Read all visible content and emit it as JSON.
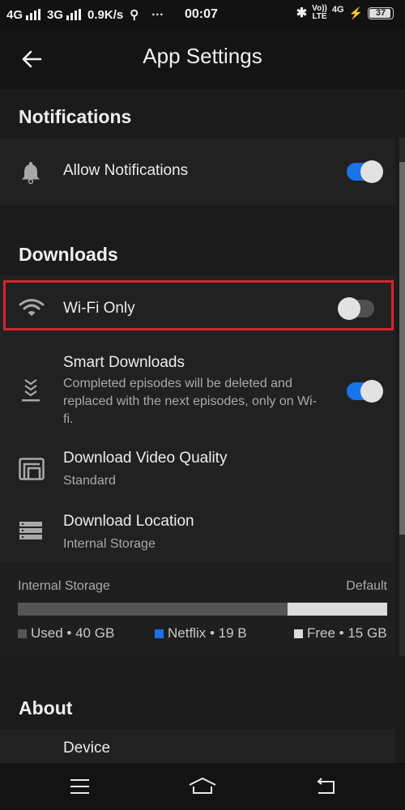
{
  "status_bar": {
    "network1": "4G",
    "network2": "3G",
    "speed": "0.9K/s",
    "usb_icon": "usb-icon",
    "more": "···",
    "time": "00:07",
    "volte_top": "Vo))",
    "volte_bottom": "LTE",
    "data_type": "4G",
    "battery_level": "37"
  },
  "app_bar": {
    "back_icon": "arrow-left-icon",
    "title": "App Settings"
  },
  "sections": {
    "notifications": {
      "heading": "Notifications",
      "allow": {
        "label": "Allow Notifications",
        "icon": "bell-icon",
        "enabled": true
      }
    },
    "downloads": {
      "heading": "Downloads",
      "wifi_only": {
        "label": "Wi-Fi Only",
        "icon": "wifi-icon",
        "enabled": false,
        "highlighted": true
      },
      "smart_downloads": {
        "label": "Smart Downloads",
        "description": "Completed episodes will be deleted and replaced with the next episodes, only on Wi-fi.",
        "icon": "smart-downloads-icon",
        "enabled": true
      },
      "video_quality": {
        "label": "Download Video Quality",
        "value": "Standard",
        "icon": "video-quality-icon"
      },
      "location": {
        "label": "Download Location",
        "value": "Internal Storage",
        "icon": "storage-icon"
      }
    },
    "storage": {
      "title": "Internal Storage",
      "badge": "Default",
      "used_fraction": 0.73,
      "legend": [
        {
          "label": "Used • 40 GB",
          "color": "#555555"
        },
        {
          "label": "Netflix • 19 B",
          "color": "#1a73e8"
        },
        {
          "label": "Free • 15 GB",
          "color": "#dcdcdc"
        }
      ]
    },
    "about": {
      "heading": "About",
      "device": {
        "label": "Device"
      }
    }
  },
  "nav_bar": {
    "menu_icon": "menu-icon",
    "home_icon": "home-icon",
    "back_icon": "back-icon"
  },
  "colors": {
    "accent": "#1a73e8",
    "highlight": "#d7232e",
    "background": "#1b1b1b"
  }
}
